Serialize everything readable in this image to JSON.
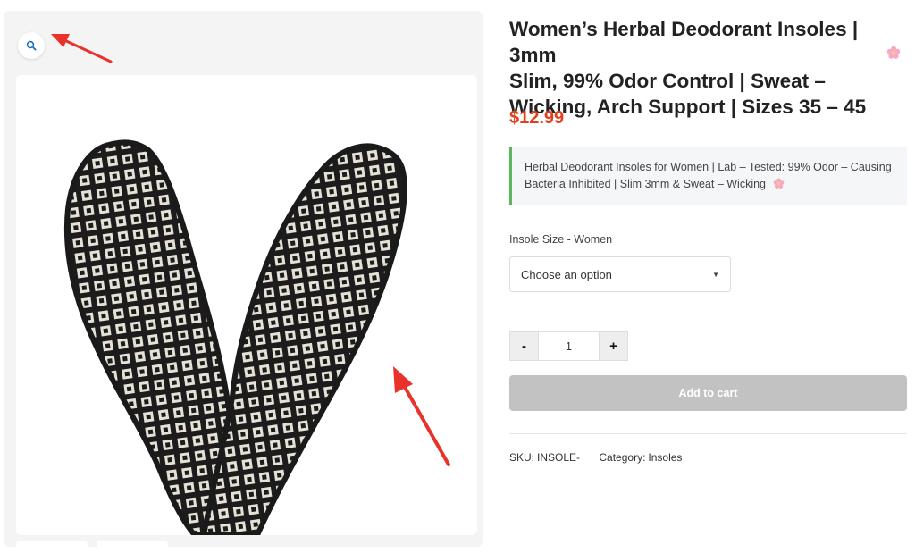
{
  "product": {
    "title_lines": [
      "Women’s Herbal Deodorant Insoles | 3mm",
      "Slim, 99% Odor Control | Sweat –",
      "Wicking, Arch Support | Sizes 35 – 45"
    ],
    "price": "$12.99",
    "short_description": "Herbal Deodorant Insoles for Women | Lab – Tested: 99% Odor – Causing Bacteria Inhibited | Slim 3mm & Sweat – Wicking"
  },
  "variation": {
    "label": "Insole Size - Women",
    "selected": "Choose an option"
  },
  "quantity": {
    "minus_label": "-",
    "value": "1",
    "plus_label": "+"
  },
  "cart": {
    "button_label": "Add to cart"
  },
  "meta": {
    "sku_label": "SKU:",
    "sku_value": "INSOLE-",
    "category_label": "Category:",
    "category_value": "Insoles"
  },
  "icons": {
    "zoom": "magnifier-icon",
    "flower": "cherry-blossom-icon",
    "caret": "chevron-down-icon"
  },
  "colors": {
    "price": "#e2401c",
    "accent_border": "#5cb85c",
    "add_to_cart_disabled": "#c2c2c2",
    "annotation_arrow": "#e8322a"
  }
}
